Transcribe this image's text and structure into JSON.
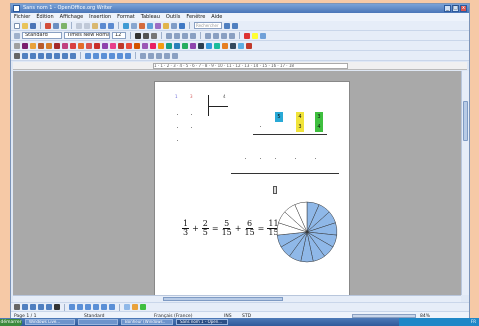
{
  "window": {
    "title": "Sans nom 1 - OpenOffice.org Writer",
    "controls": [
      "_",
      "□",
      "x"
    ]
  },
  "menu": [
    "Fichier",
    "Édition",
    "Affichage",
    "Insertion",
    "Format",
    "Tableau",
    "Outils",
    "Fenêtre",
    "Aide"
  ],
  "toolbar": {
    "style_value": "Standard",
    "font_value": "Times New Roman",
    "size_value": "12",
    "search_placeholder": "Rechercher"
  },
  "ruler": {
    "ticks": "1 · 1 · 2 · 3 · 4 · 5 · 6 · 7 · 8 · 9 · 10 · 11 · 12 · 13 · 14 · 15 · 16 · 17 · 18"
  },
  "document": {
    "top_numbers": [
      "1",
      "3",
      "4"
    ],
    "colored_digits": [
      {
        "value": "5",
        "color": "#29a9d6"
      },
      {
        "value": "4",
        "color": "#f1e43a"
      },
      {
        "value": "3",
        "color": "#3fbf3f"
      },
      {
        "value": "3",
        "color": "#f1e43a"
      },
      {
        "value": "4",
        "color": "#3fbf3f"
      }
    ],
    "equation": {
      "fractions": [
        {
          "num": "1",
          "den": "3"
        },
        {
          "num": "2",
          "den": "5"
        },
        {
          "num": "5",
          "den": "15"
        },
        {
          "num": "6",
          "den": "15"
        },
        {
          "num": "11",
          "den": "15"
        }
      ],
      "operators": [
        "+",
        "=",
        "+",
        "="
      ]
    },
    "pie": {
      "slices": 15,
      "filled": 11,
      "fill_color": "#8fb8e8",
      "empty_color": "#ffffff"
    }
  },
  "statusbar": {
    "page": "Page 1 / 1",
    "style": "Standard",
    "language": "Français (France)",
    "mode": "INS",
    "std": "STD",
    "zoom": "84%"
  },
  "taskbar": {
    "start": "démarrer",
    "tasks": [
      "Windows Live...",
      "",
      "Bonheur (Windows..",
      "Sans nom 1 - Open..."
    ],
    "clock": "FR"
  }
}
